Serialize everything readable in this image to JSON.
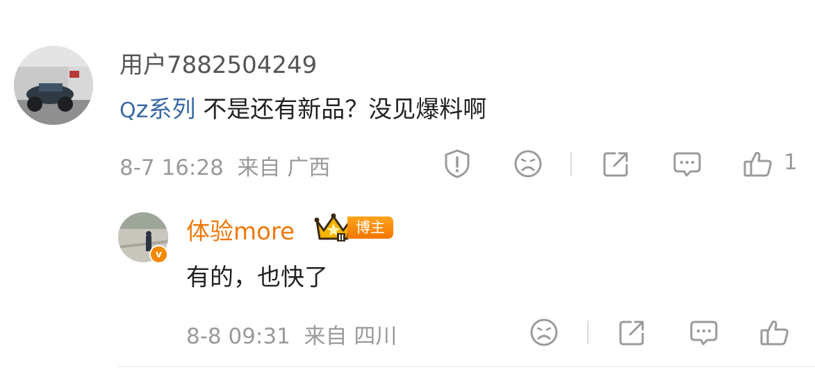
{
  "comment": {
    "username": "用户7882504249",
    "topic": "z系列",
    "topic_prefix": "Q",
    "text": " 不是还有新品？没见爆料啊",
    "date": "8-7 16:28",
    "from_label": "来自",
    "location": "广西",
    "like_count": "1",
    "icons": [
      "report-icon",
      "dislike-icon",
      "share-icon",
      "comment-icon",
      "like-icon"
    ]
  },
  "reply": {
    "username": "体验more",
    "badge": "博主",
    "verify_mark": "v",
    "text": "有的，也快了",
    "date": "8-8 09:31",
    "from_label": "来自",
    "location": "四川",
    "icons": [
      "dislike-icon",
      "share-icon",
      "comment-icon",
      "like-icon"
    ]
  },
  "colors": {
    "topic_link": "#3a6aa4",
    "reply_username": "#f0780b",
    "badge_bg": "#f27600",
    "meta_text": "#9a9a9a"
  }
}
